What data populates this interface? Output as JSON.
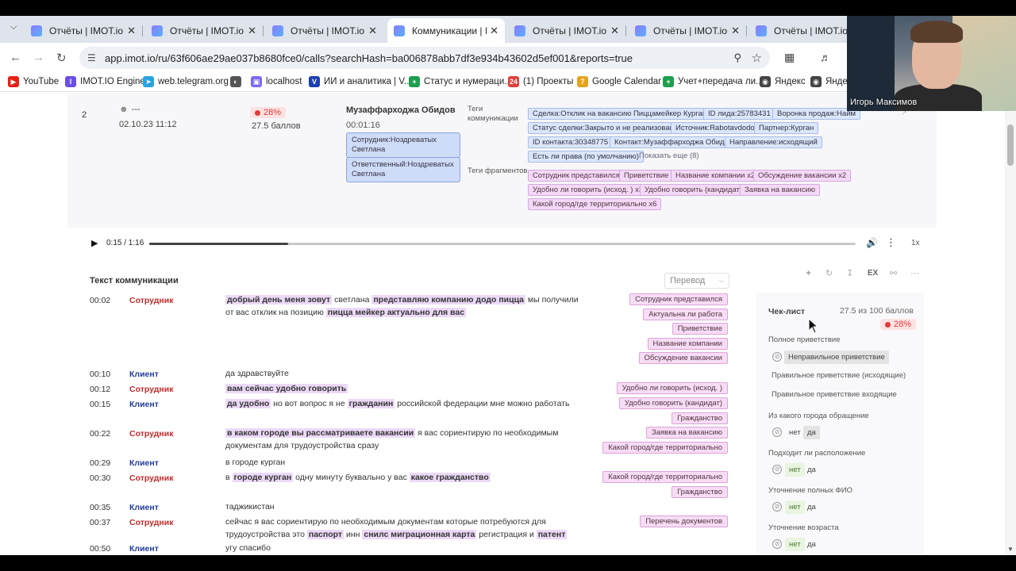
{
  "browser": {
    "tabs": [
      {
        "label": "Отчёты | IMOT.io",
        "active": false
      },
      {
        "label": "Отчёты | IMOT.io",
        "active": false
      },
      {
        "label": "Отчёты | IMOT.io",
        "active": false
      },
      {
        "label": "Коммуникации | IM",
        "active": true
      },
      {
        "label": "Отчёты | IMOT.io",
        "active": false
      },
      {
        "label": "Отчёты | IMOT.io",
        "active": false
      },
      {
        "label": "Отчёты | IMOT.io",
        "active": false
      }
    ],
    "url": "app.imot.io/ru/63f606ae29ae037b8680fce0/calls?searchHash=ba006878abb7df3e934b43602d5ef001&reports=true",
    "bookmarks": [
      {
        "label": "YouTube",
        "color": "#e62117"
      },
      {
        "label": "IMOT.IO Engine",
        "color": "#6b4ee8"
      },
      {
        "label": "web.telegram.org",
        "color": "#2aa3df"
      },
      {
        "label": "",
        "color": "#555555"
      },
      {
        "label": "localhost",
        "color": "#7a6af0"
      },
      {
        "label": "ИИ и аналитика | V...",
        "color": "#1a3fb3"
      },
      {
        "label": "Статус и нумераци...",
        "color": "#1e9e4e"
      },
      {
        "label": "(1) Проекты",
        "color": "#e0403a"
      },
      {
        "label": "Google Calendar",
        "color": "#e8a31c"
      },
      {
        "label": "Учет+передача ли...",
        "color": "#1e9e4e"
      },
      {
        "label": "Яндекс",
        "color": "#444444"
      },
      {
        "label": "Яндекс",
        "color": "#444444"
      }
    ]
  },
  "call": {
    "number": "2",
    "person": "---",
    "date": "02.10.23 11:12",
    "score_percent": "28%",
    "score_points": "27.5 баллов",
    "client_name": "Музаффарходжа Обидов",
    "duration": "00:01:16",
    "employee_box": "Сотрудник:Ноздреватых Светлана",
    "responsible_box": "Ответственный:Ноздреватых Светлана",
    "tags_label": "Теги коммуникации",
    "fragments_label": "Теги фрагментов",
    "comm_tags": [
      "Сделка:Отклик на вакансию Пиццамейкер Курган-3",
      "ID лида:25783431",
      "Воронка продаж:Найм",
      "Статус сделки:Закрыто и не реализовано",
      "Источник:Rabotavdodo",
      "Партнер:Курган",
      "ID контакта:30348775",
      "Контакт:Музаффарходжа Обидов",
      "Направление:исходящий",
      "Есть ли права (по умолчанию)"
    ],
    "show_more": "Показать еще (8)",
    "fragment_tags": [
      "Сотрудник представился",
      "Приветствие",
      "Название компании x2",
      "Обсуждение вакансии x2",
      "Удобно ли говорить (исход. ) x3",
      "Удобно говорить (кандидат)",
      "Заявка на вакансию",
      "Какой город/где территориально x6"
    ]
  },
  "player": {
    "time": "0:15 / 1:16",
    "progress": 0.197,
    "speed": "1x"
  },
  "transcript": {
    "title": "Текст коммуникации",
    "translate": "Перевод",
    "lines": [
      {
        "time": "00:02",
        "speaker": "Сотрудник",
        "role": "emp",
        "parts": [
          {
            "t": "добрый день меня зовут",
            "h": true
          },
          {
            "t": " светлана ",
            "h": false
          },
          {
            "t": "представляю компанию додо пицца",
            "h": true
          },
          {
            "t": " мы получили от вас отклик на позицию ",
            "h": false
          },
          {
            "t": "пицца мейкер актуально для вас",
            "h": true
          }
        ],
        "tags": [
          "Сотрудник представился",
          "Актуальна ли работа",
          "Приветствие",
          "Название компании",
          "Обсуждение вакансии"
        ]
      },
      {
        "time": "00:10",
        "speaker": "Клиент",
        "role": "cli",
        "parts": [
          {
            "t": "да здравствуйте",
            "h": false
          }
        ],
        "tags": []
      },
      {
        "time": "00:12",
        "speaker": "Сотрудник",
        "role": "emp",
        "parts": [
          {
            "t": "вам сейчас удобно говорить",
            "h": true
          }
        ],
        "tags": [
          "Удобно ли говорить (исход. )"
        ]
      },
      {
        "time": "00:15",
        "speaker": "Клиент",
        "role": "cli",
        "parts": [
          {
            "t": "да удобно",
            "h": true
          },
          {
            "t": " но вот вопрос я не ",
            "h": false
          },
          {
            "t": "гражданин",
            "h": true
          },
          {
            "t": " российской федерации мне можно работать",
            "h": false
          }
        ],
        "tags": [
          "Удобно говорить (кандидат)",
          "Гражданство"
        ]
      },
      {
        "time": "00:22",
        "speaker": "Сотрудник",
        "role": "emp",
        "parts": [
          {
            "t": "в каком городе вы рассматриваете вакансии",
            "h": true
          },
          {
            "t": " я вас сориентирую по необходимым документам для трудоустройства сразу",
            "h": false
          }
        ],
        "tags": [
          "Заявка на вакансию",
          "Какой город/где территориально"
        ]
      },
      {
        "time": "00:29",
        "speaker": "Клиент",
        "role": "cli",
        "parts": [
          {
            "t": "в городе курган",
            "h": false
          }
        ],
        "tags": []
      },
      {
        "time": "00:30",
        "speaker": "Сотрудник",
        "role": "emp",
        "parts": [
          {
            "t": "в ",
            "h": false
          },
          {
            "t": "городе курган",
            "h": true
          },
          {
            "t": " одну минуту буквально у вас ",
            "h": false
          },
          {
            "t": "какое гражданство",
            "h": true
          }
        ],
        "tags": [
          "Какой город/где территориально",
          "Гражданство"
        ]
      },
      {
        "time": "00:35",
        "speaker": "Клиент",
        "role": "cli",
        "parts": [
          {
            "t": "таджикистан",
            "h": false
          }
        ],
        "tags": []
      },
      {
        "time": "00:37",
        "speaker": "Сотрудник",
        "role": "emp",
        "parts": [
          {
            "t": "сейчас я вас сориентирую по необходимым документам которые потребуются для трудоустройства это ",
            "h": false
          },
          {
            "t": "паспорт",
            "h": true
          },
          {
            "t": " инн ",
            "h": false
          },
          {
            "t": "снилс миграционная карта",
            "h": true
          },
          {
            "t": " регистрация и ",
            "h": false
          },
          {
            "t": "патент",
            "h": true
          }
        ],
        "tags": [
          "Перечень документов"
        ]
      },
      {
        "time": "00:50",
        "speaker": "Клиент",
        "role": "cli",
        "parts": [
          {
            "t": "угу спасибо",
            "h": false
          }
        ],
        "tags": []
      }
    ]
  },
  "checklist": {
    "title": "Чек-лист",
    "score": "27.5 из 100 баллов",
    "percent": "28%",
    "toolbar_ex": "EX",
    "q1_label": "Полное приветствие",
    "q1_options": [
      "Неправильное приветствие",
      "Правильное приветствие (исходящие)",
      "Правильное приветствие входящие"
    ],
    "questions": [
      {
        "label": "Из какого города обращение",
        "no": "нет",
        "yes": "да",
        "selected": "yes"
      },
      {
        "label": "Подходит ли расположение",
        "no": "нет",
        "yes": "да",
        "selected": "no"
      },
      {
        "label": "Уточнение полных ФИО",
        "no": "нет",
        "yes": "да",
        "selected": "no"
      },
      {
        "label": "Уточнение возраста",
        "no": "нет",
        "yes": "да",
        "selected": "no"
      }
    ]
  },
  "webcam": {
    "name": "Игорь Максимов"
  },
  "colors": {
    "employee": "#c42a2a",
    "client": "#233b9a",
    "highlight": "#ecd9f7",
    "danger": "#e03a3a"
  }
}
